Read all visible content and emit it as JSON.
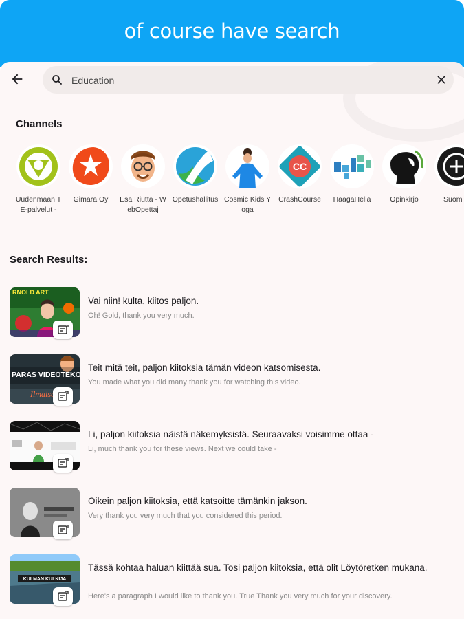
{
  "banner": {
    "title": "of course have search"
  },
  "search": {
    "value": "Education"
  },
  "channels_heading": "Channels",
  "channels": [
    {
      "name": "Uudenmaan TE-palvelut -",
      "icon": "uudenmaan-logo-icon"
    },
    {
      "name": "Gimara Oy",
      "icon": "gimara-logo-icon"
    },
    {
      "name": "Esa Riutta - WebOpettaj",
      "icon": "cartoon-avatar-icon"
    },
    {
      "name": "Opetushallitus",
      "icon": "opetushallitus-logo-icon"
    },
    {
      "name": "Cosmic Kids Yoga",
      "icon": "yoga-presenter-icon"
    },
    {
      "name": "CrashCourse",
      "icon": "crashcourse-logo-icon"
    },
    {
      "name": "HaagaHelia",
      "icon": "haagahelia-logo-icon"
    },
    {
      "name": "Opinkirjo",
      "icon": "portrait-silhouette-icon"
    },
    {
      "name": "Suom H",
      "icon": "circle-logo-icon"
    }
  ],
  "results_heading": "Search Results:",
  "results": [
    {
      "title": "Vai niin! kulta, kiitos paljon.",
      "subtitle": "Oh! Gold, thank you very much.",
      "thumb_text": "RNOLD ART"
    },
    {
      "title": "Teit mitä teit, paljon kiitoksia tämän videon katsomisesta.",
      "subtitle": "You made what you did many thank you for watching this video.",
      "thumb_text": "PARAS VIDEOTEKOÄLY!"
    },
    {
      "title": "Li, paljon kiitoksia näistä näkemyksistä. Seuraavaksi voisimme ottaa -",
      "subtitle": "Li, much thank you for these views. Next we could take -",
      "thumb_text": ""
    },
    {
      "title": "Oikein paljon kiitoksia, että katsoitte tämänkin jakson.",
      "subtitle": "Very thank you very much that you considered this period.",
      "thumb_text": ""
    },
    {
      "title": "Tässä kohtaa haluan kiittää sua. Tosi paljon kiitoksia, että olit Löytöretken mukana.",
      "subtitle": "Here's a paragraph I would like to thank you. True Thank you very much for your discovery.",
      "thumb_text": "KULMAN KULKIJA"
    }
  ],
  "icons": {
    "back": "arrow-left-icon",
    "search": "magnifier-icon",
    "clear": "close-icon",
    "badge": "transcript-icon"
  },
  "colors": {
    "banner": "#0ea5f5",
    "background": "#fdf7f7",
    "search_field": "#f1ebea"
  }
}
